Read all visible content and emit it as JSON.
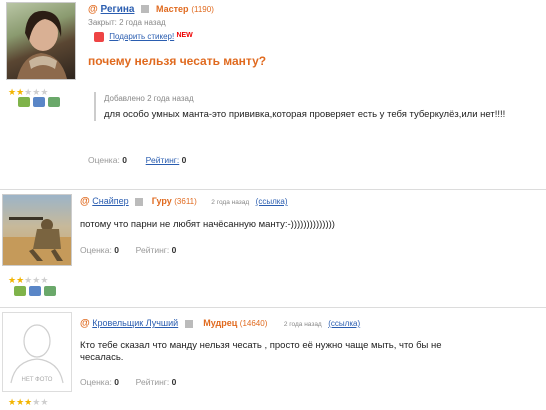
{
  "q": {
    "author": "Регина",
    "rank": "Мастер",
    "points": "(1190)",
    "closed": "Закрыт: 2 года назад",
    "gift": "Подарить стикер!",
    "gift_badge": "NEW",
    "title": "почему нельзя чесать манту?",
    "added": "Добавлено 2 года назад",
    "text": "для особо умных манта-это прививка,которая проверяет есть у тебя туберкулёз,или нет!!!!",
    "rating_label": "Оценка:",
    "rating_value": "0",
    "reyting_label": "Рейтинг:",
    "reyting_value": "0"
  },
  "a1": {
    "author": "Снайпер",
    "rank": "Гуру",
    "points": "(3611)",
    "time": "2 года назад",
    "link": "(ссылка)",
    "text": "потому что парни не любят начёсанную манту:-))))))))))))))",
    "rating_label": "Оценка:",
    "rating_value": "0",
    "reyting_label": "Рейтинг:",
    "reyting_value": "0"
  },
  "a2": {
    "author": "Кровельщик Лучший",
    "rank": "Мудрец",
    "points": "(14640)",
    "time": "2 года назад",
    "link": "(ссылка)",
    "text": "Кто тебе сказал что манду нельзя чесать , просто её нужно чаще мыть, что бы не чесалась.",
    "no_photo": "НЕТ ФОТО",
    "rating_label": "Оценка:",
    "rating_value": "0",
    "reyting_label": "Рейтинг:",
    "reyting_value": "0"
  },
  "colors": {
    "accent": "#e06a1f",
    "link": "#2a5db0",
    "divider": "#dcdcdc"
  }
}
